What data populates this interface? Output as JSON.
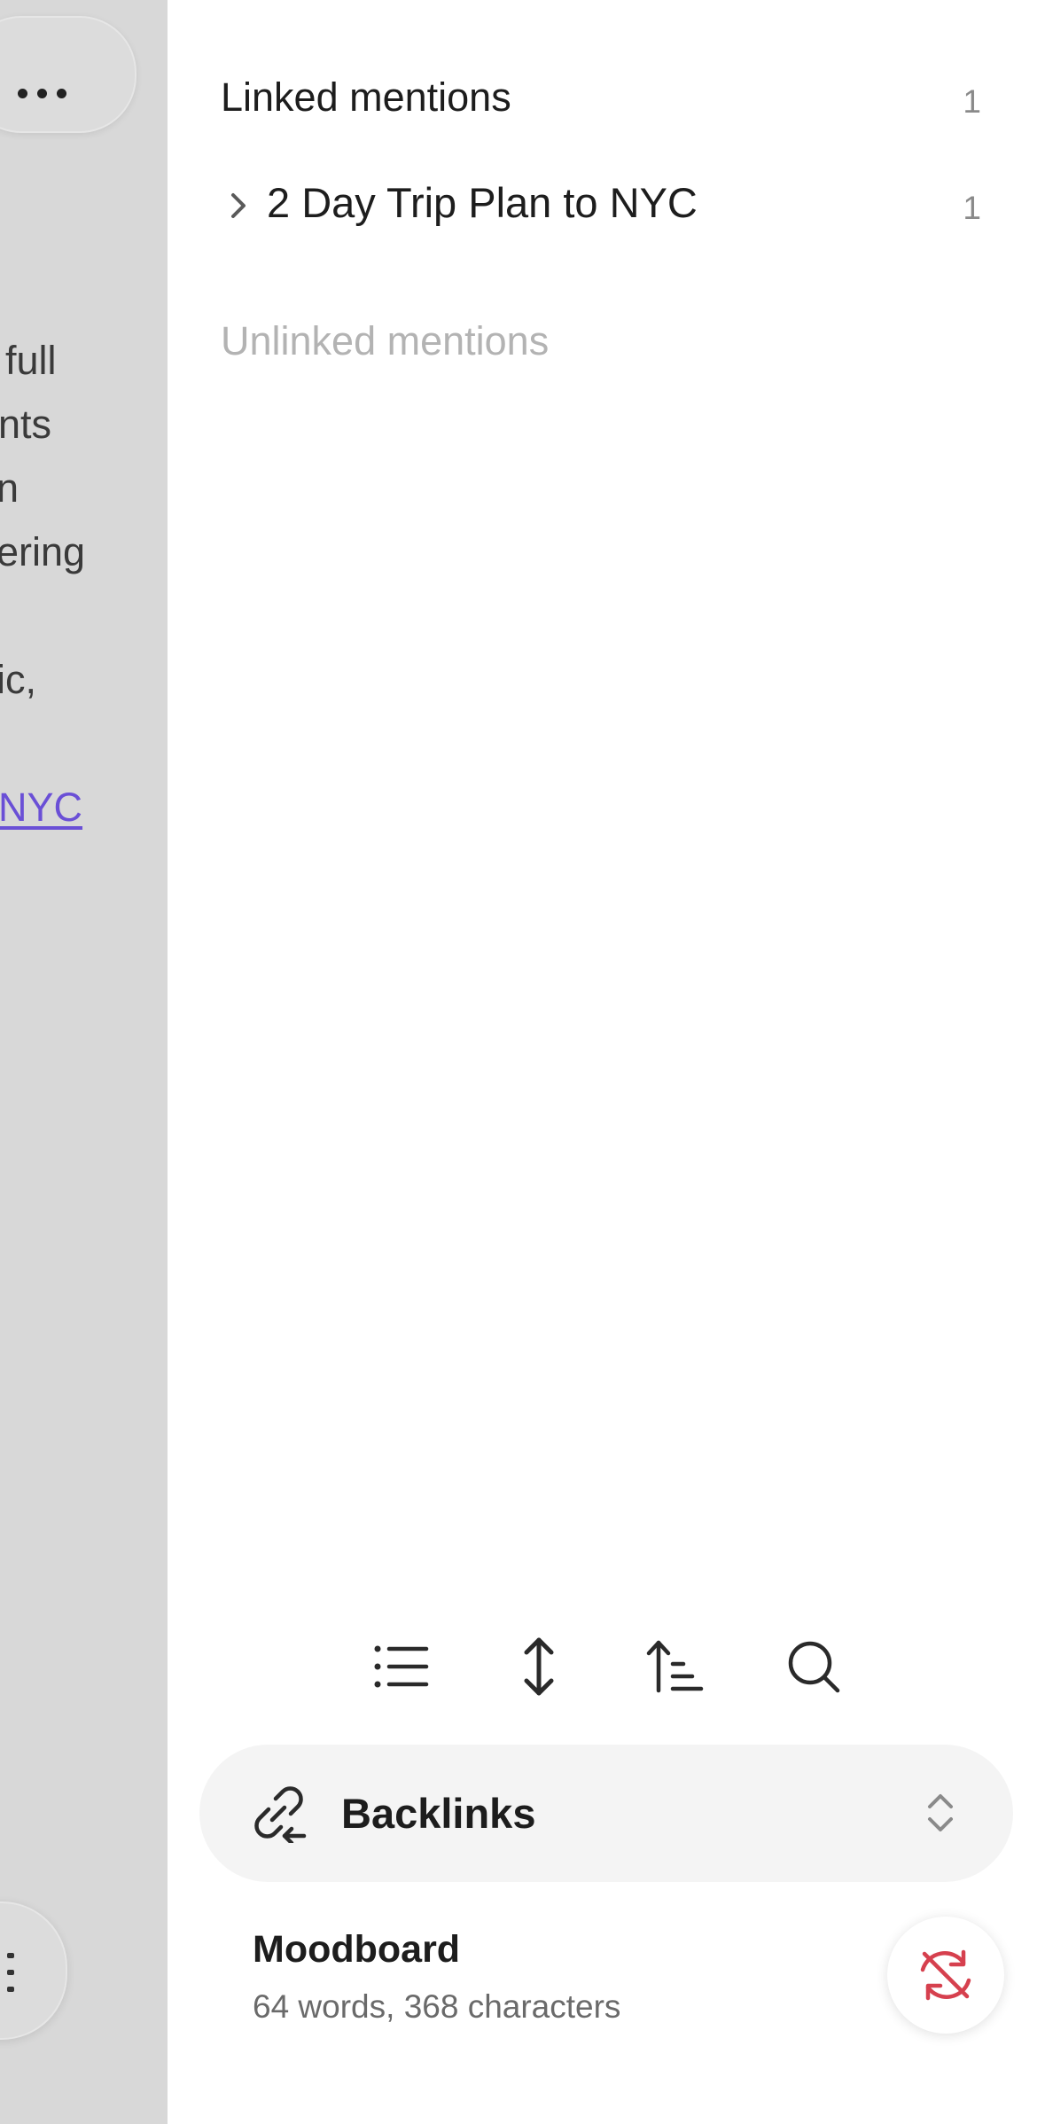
{
  "background_editor": {
    "lines": [
      "full",
      "nts",
      "n",
      "ering",
      "ic,"
    ],
    "link_text": "NYC",
    "link_color": "#6a4fd6"
  },
  "linked_mentions": {
    "title": "Linked mentions",
    "count": "1",
    "items": [
      {
        "title": "2 Day Trip Plan to NYC",
        "count": "1",
        "icon": "chevron-right-icon"
      }
    ]
  },
  "unlinked_mentions": {
    "title": "Unlinked mentions"
  },
  "toolbar": {
    "icons": [
      "list-icon",
      "expand-vertical-icon",
      "sort-ascending-icon",
      "search-icon"
    ]
  },
  "panel_selector": {
    "icon": "backlink-icon",
    "label": "Backlinks",
    "trailing_icon": "chevron-up-down-icon"
  },
  "document": {
    "title": "Moodboard",
    "stats": "64 words, 368 characters"
  },
  "sync_button": {
    "icon": "sync-off-icon",
    "color": "#d6404e"
  }
}
